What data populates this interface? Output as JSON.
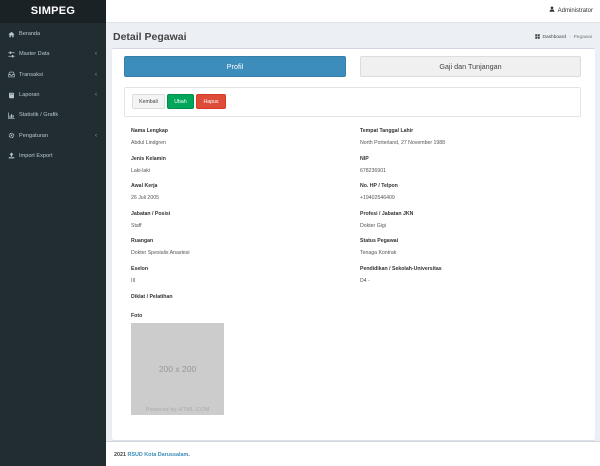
{
  "app": {
    "name": "SIMPEG"
  },
  "user": {
    "name": "Administrator",
    "icon": "user-icon"
  },
  "sidebar": {
    "items": [
      {
        "label": "Beranda",
        "icon": "home-icon",
        "has_submenu": false
      },
      {
        "label": "Master Data",
        "icon": "sliders-icon",
        "has_submenu": true
      },
      {
        "label": "Transaksi",
        "icon": "inbox-icon",
        "has_submenu": true
      },
      {
        "label": "Laporan",
        "icon": "book-icon",
        "has_submenu": true
      },
      {
        "label": "Statistik / Grafik",
        "icon": "bar-chart-icon",
        "has_submenu": false
      },
      {
        "label": "Pengaturan",
        "icon": "gear-icon",
        "has_submenu": true
      },
      {
        "label": "Import Export",
        "icon": "upload-icon",
        "has_submenu": false
      }
    ]
  },
  "header": {
    "title": "Detail Pegawai",
    "breadcrumb": {
      "home": "Dashboard",
      "current": "Pegawai"
    }
  },
  "tabs": [
    {
      "label": "Profil",
      "active": true
    },
    {
      "label": "Gaji dan Tunjangan",
      "active": false
    }
  ],
  "actions": {
    "kembali": "Kembali",
    "ubah": "Ubah",
    "hapus": "Hapus"
  },
  "details": {
    "left": [
      {
        "label": "Nama Lengkap",
        "value": "Abdul Lindgren"
      },
      {
        "label": "Jenis Kelamin",
        "value": "Laki-laki"
      },
      {
        "label": "Awal Kerja",
        "value": "26 Juli 2005"
      },
      {
        "label": "Jabatan / Posisi",
        "value": "Staff"
      },
      {
        "label": "Ruangan",
        "value": "Dokter Spesialis Anastesi"
      },
      {
        "label": "Eselon",
        "value": "III"
      },
      {
        "label": "Diklat / Pelatihan",
        "value": ""
      }
    ],
    "right": [
      {
        "label": "Tempat Tanggal Lahir",
        "value": "North Porterland, 27 November 1988"
      },
      {
        "label": "NIP",
        "value": "678236901"
      },
      {
        "label": "No. HP / Telpon",
        "value": "+19402546409"
      },
      {
        "label": "Profesi / Jabatan JKN",
        "value": "Dokter Gigi"
      },
      {
        "label": "Status Pegawai",
        "value": "Tenaga Kontrak"
      },
      {
        "label": "Pendidikan / Sekolah-Universitas",
        "value": "D4 -"
      }
    ]
  },
  "photo": {
    "label": "Foto",
    "placeholder_size": "200 x 200",
    "placeholder_credit": "Powered by HTML.COM"
  },
  "footer": {
    "year": "2021",
    "org": "RSUD Kota Darussalam",
    "suffix": "."
  }
}
